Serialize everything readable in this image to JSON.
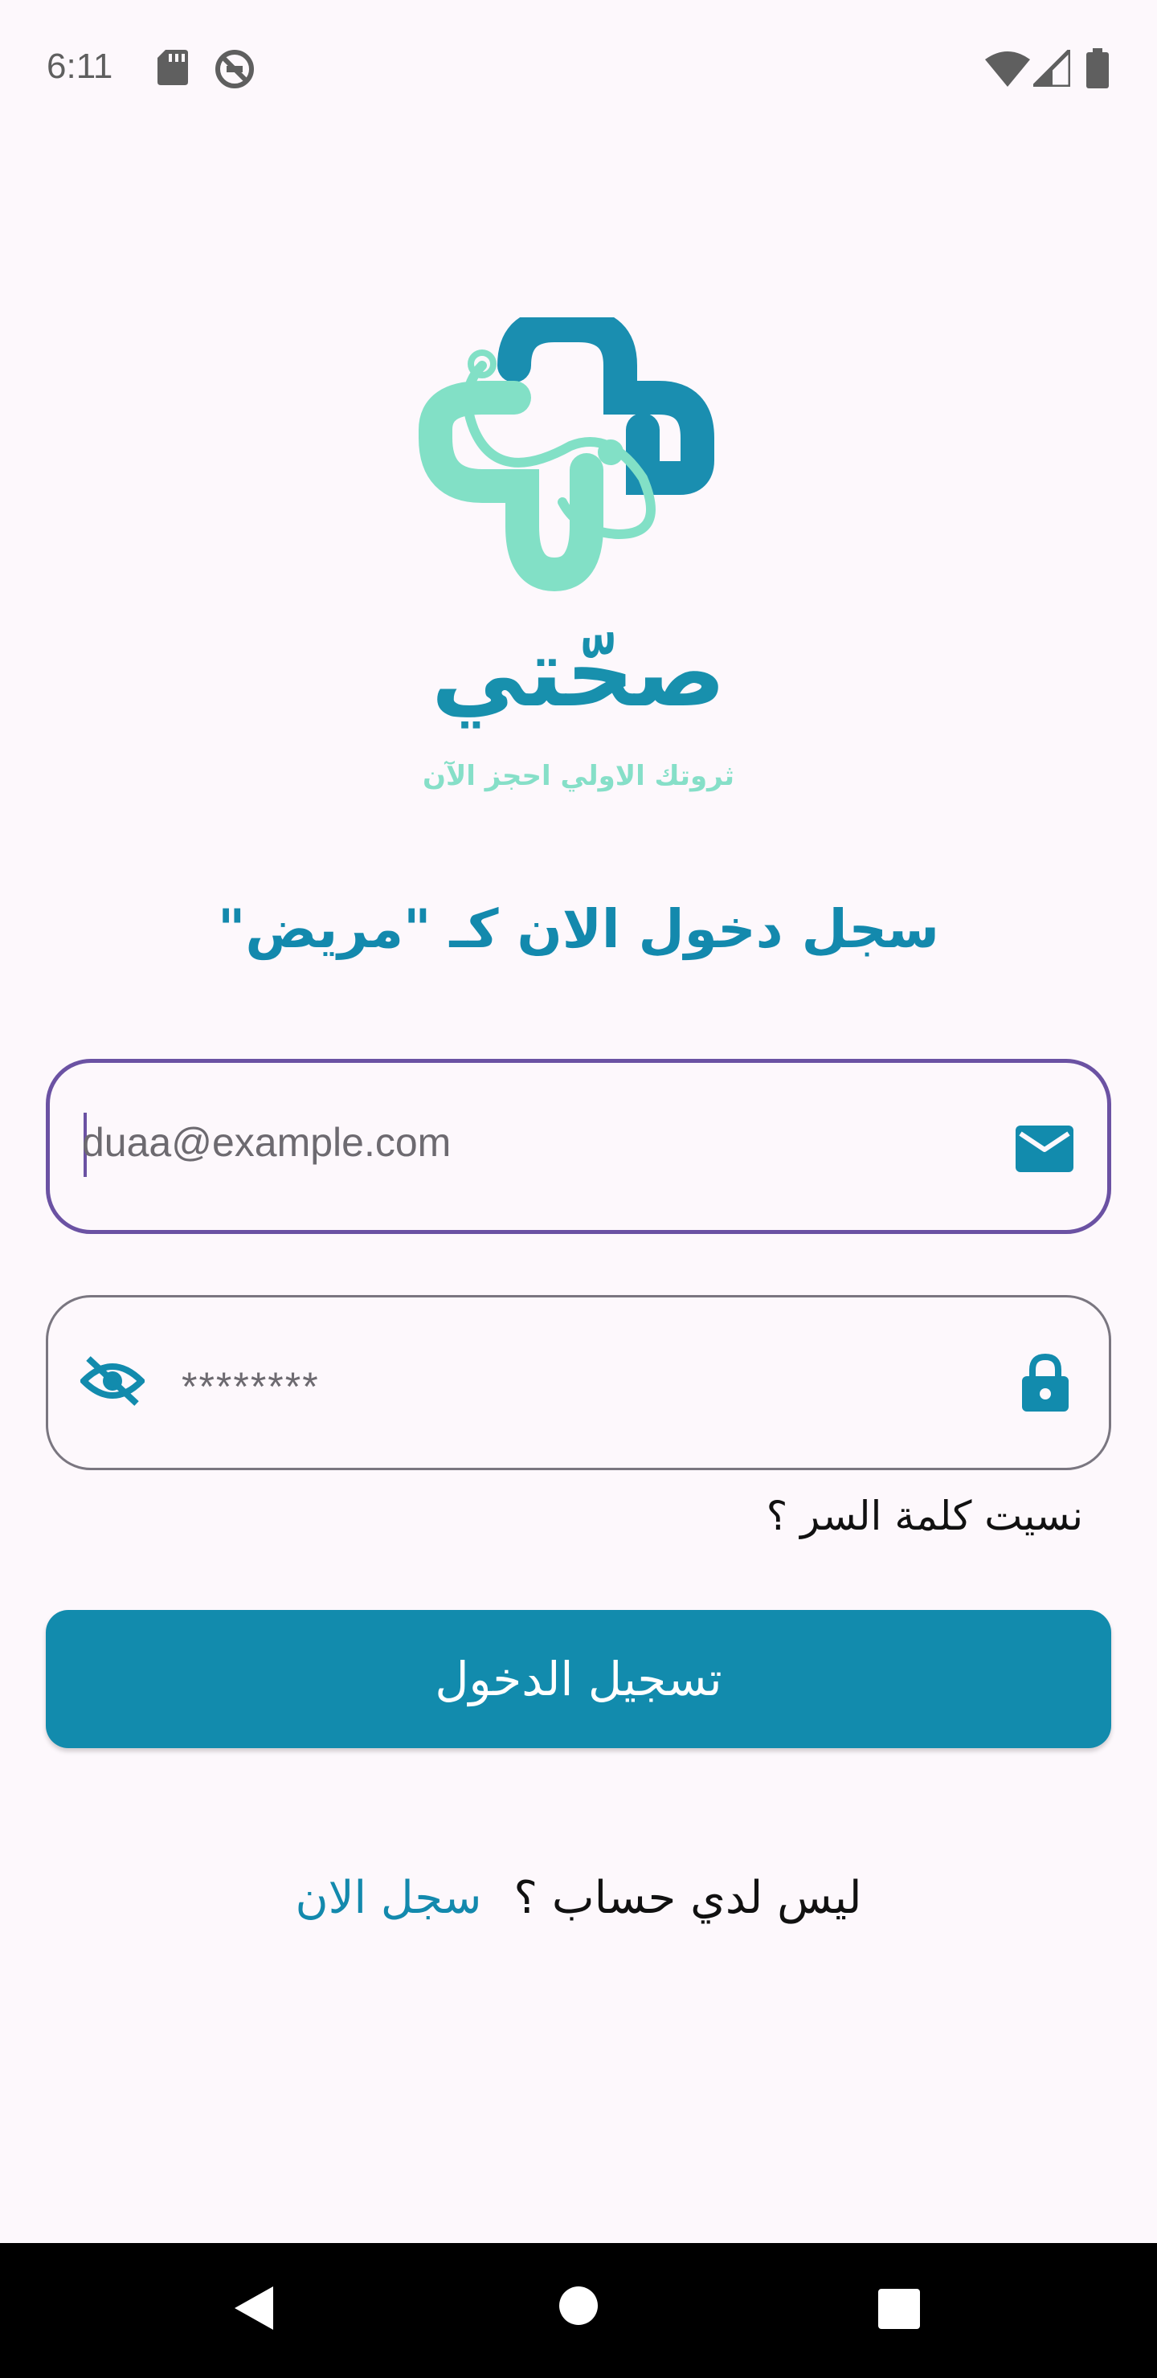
{
  "status_bar": {
    "time": "6:11",
    "icons": [
      "sd-card-icon",
      "do-not-disturb-icon",
      "wifi-icon",
      "signal-icon",
      "battery-icon"
    ]
  },
  "brand": {
    "name": "صحّتي",
    "tagline": "ثروتك الاولي احجز الآن",
    "colors": {
      "primary": "#1389ad",
      "mint": "#86dfc8"
    }
  },
  "login": {
    "heading": "سجل دخول الان كـ \"مريض\"",
    "email": {
      "value": "duaa@example.com",
      "icon": "mail-icon"
    },
    "password": {
      "value": "********",
      "icons": [
        "visibility-off-icon",
        "lock-icon"
      ]
    },
    "forgot_password": "نسيت كلمة السر ؟",
    "submit_label": "تسجيل الدخول",
    "no_account_text": "ليس لدي حساب ؟",
    "signup_link": "سجل الان"
  },
  "nav_bar": {
    "icons": [
      "back-icon",
      "home-icon",
      "recents-icon"
    ]
  }
}
